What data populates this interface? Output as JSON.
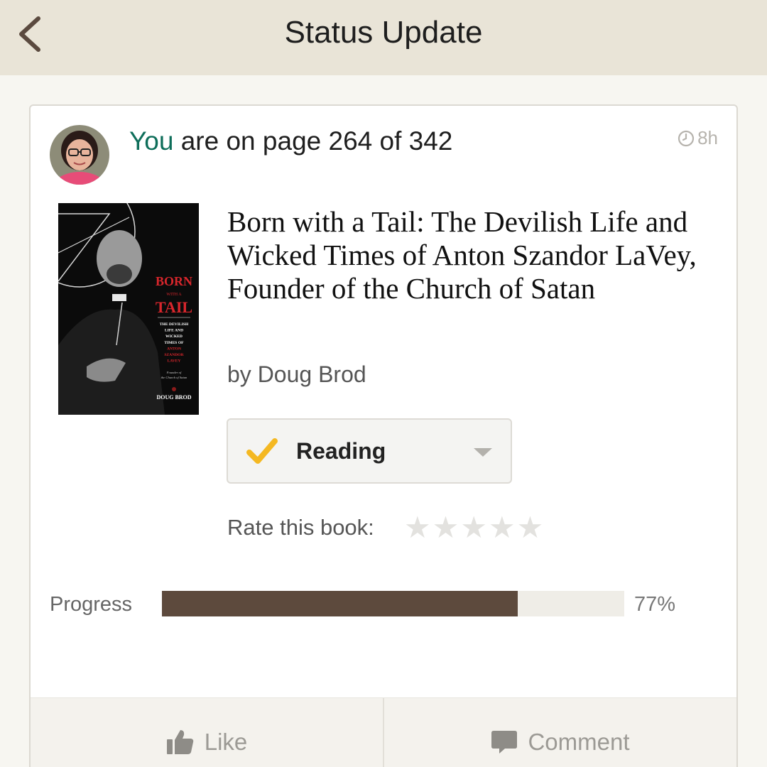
{
  "nav": {
    "title": "Status Update",
    "back_icon": "chevron-left-icon"
  },
  "status": {
    "actor": "You",
    "rest": " are on page 264 of 342",
    "time": "8h",
    "time_icon": "clock-icon"
  },
  "book": {
    "title": "Born with a Tail: The Devilish Life and Wicked Times of Anton Szandor LaVey, Founder of the Church of Satan",
    "author_prefix": "by ",
    "author": "Doug Brod",
    "cover_text": {
      "born": "BORN",
      "with_a": "WITH A",
      "tail": "TAIL",
      "subtitle_lines": [
        "THE DEVILISH",
        "LIFE AND",
        "WICKED",
        "TIMES OF",
        "ANTON",
        "SZANDOR",
        "LAVEY"
      ],
      "founder_lines": [
        "Founder of",
        "the Church of Satan"
      ],
      "author": "DOUG BROD"
    }
  },
  "shelf": {
    "label": "Reading",
    "icon": "checkmark-icon",
    "dropdown_icon": "caret-down-icon"
  },
  "rating": {
    "label": "Rate this book:",
    "star_glyph": "★",
    "max": 5,
    "value": 0
  },
  "progress": {
    "label": "Progress",
    "percent": 77,
    "percent_text": "77%"
  },
  "actions": {
    "like": "Like",
    "like_icon": "thumbs-up-icon",
    "comment": "Comment",
    "comment_icon": "speech-bubble-icon"
  },
  "colors": {
    "accent_green": "#0e6e5a",
    "progress_fill": "#5d4a3d",
    "check_yellow": "#f4b822"
  }
}
